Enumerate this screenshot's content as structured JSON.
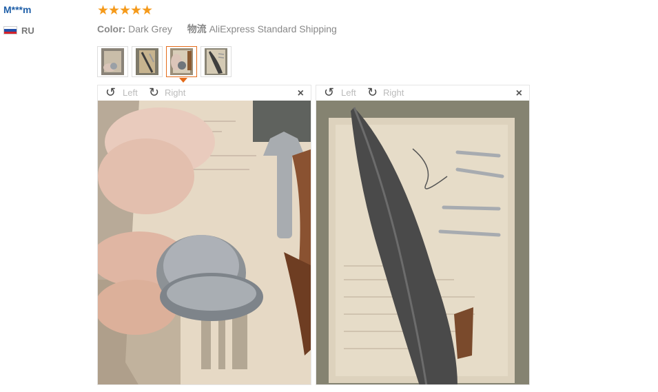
{
  "review": {
    "username": "M***m",
    "country": "RU",
    "rating": 5,
    "stars": [
      "★",
      "★",
      "★",
      "★",
      "★"
    ],
    "color_label": "Color:",
    "color_value": "Dark Grey",
    "shipping_label": "物流",
    "shipping_value": "AliExpress Standard Shipping"
  },
  "thumbnails": [
    {
      "icon": "photo-thumbnail-1"
    },
    {
      "icon": "photo-thumbnail-2"
    },
    {
      "icon": "photo-thumbnail-3",
      "active": true
    },
    {
      "icon": "photo-thumbnail-4"
    }
  ],
  "viewers": [
    {
      "left_label": "Left",
      "right_label": "Right",
      "rotate_left_icon": "↺",
      "rotate_right_icon": "↻",
      "close_icon": "×"
    },
    {
      "left_label": "Left",
      "right_label": "Right",
      "rotate_left_icon": "↺",
      "rotate_right_icon": "↻",
      "close_icon": "×"
    }
  ],
  "colors": {
    "username": "#1f5fa8",
    "star": "#f59a1b",
    "active_thumb": "#e46b19"
  }
}
